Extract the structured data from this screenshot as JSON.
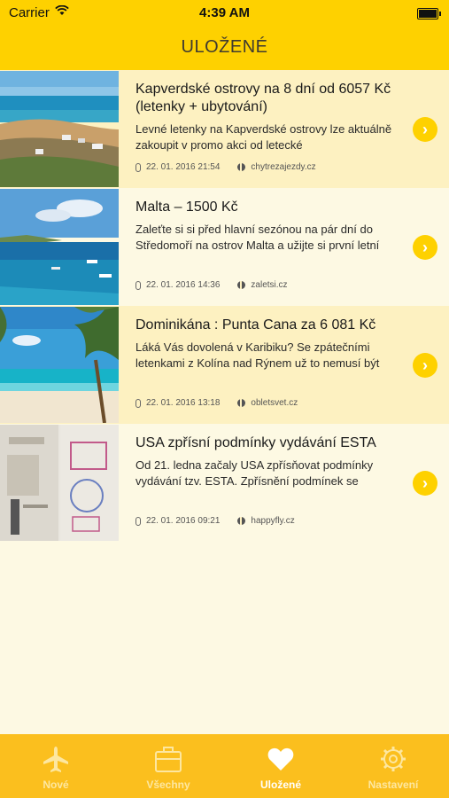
{
  "status_bar": {
    "carrier": "Carrier",
    "time": "4:39 AM"
  },
  "nav": {
    "title": "ULOŽENÉ"
  },
  "articles": [
    {
      "title": "Kapverdské ostrovy na 8 dní od 6057 Kč (letenky + ubytování)",
      "excerpt": "Levné letenky na Kapverdské ostrovy lze aktuálně zakoupit v promo akci od letecké",
      "date": "22. 01. 2016 21:54",
      "source": "chytrezajezdy.cz"
    },
    {
      "title": "Malta – 1500 Kč",
      "excerpt": "Zaleťte si si před hlavní sezónou na pár dní do Středomoří na ostrov Malta a užijte si první letní",
      "date": "22. 01. 2016 14:36",
      "source": "zaletsi.cz"
    },
    {
      "title": "Dominikána : Punta Cana za 6 081 Kč",
      "excerpt": "Láká Vás dovolená v Karibiku? Se zpátečními letenkami z Kolína nad Rýnem už to nemusí být",
      "date": "22. 01. 2016 13:18",
      "source": "obletsvet.cz"
    },
    {
      "title": "USA zpřísní podmínky vydávání ESTA",
      "excerpt": "Od 21. ledna začaly USA zpřísňovat podmínky vydávání tzv. ESTA. Zpřísnění podmínek se",
      "date": "22. 01. 2016 09:21",
      "source": "happyfly.cz"
    }
  ],
  "tabs": [
    {
      "label": "Nové",
      "icon": "airplane-icon"
    },
    {
      "label": "Všechny",
      "icon": "suitcase-icon"
    },
    {
      "label": "Uložené",
      "icon": "heart-icon"
    },
    {
      "label": "Nastavení",
      "icon": "gear-icon"
    }
  ],
  "colors": {
    "accent": "#fed100",
    "tabbar": "#fbbf1e",
    "row_highlight": "#fdf1c1",
    "background": "#fdf9e3"
  }
}
